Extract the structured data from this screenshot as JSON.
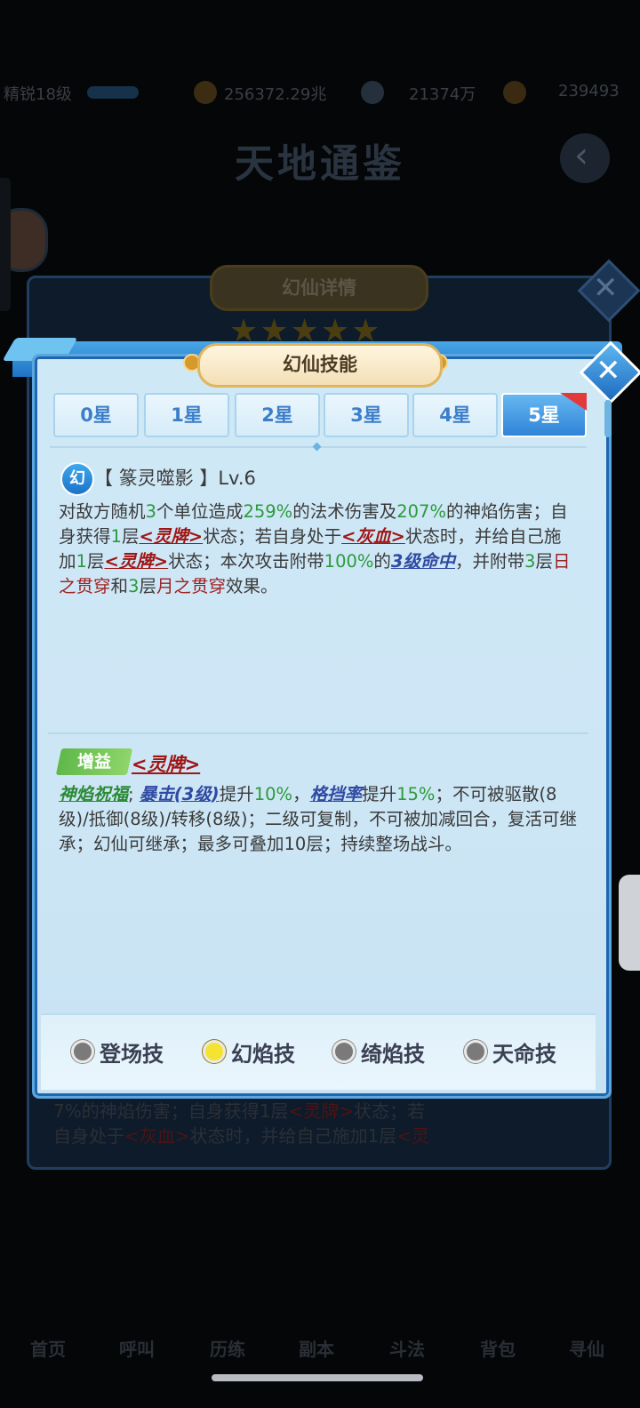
{
  "background": {
    "level_text": "精锐18级",
    "gold": "256372.29兆",
    "currency2": "21374万",
    "currency3": "239493",
    "screen_title": "天地通鉴",
    "detail_title": "幻仙详情",
    "detail_stars": "★★★★★",
    "dim_text_line1": "7%的神焰伤害；自身获得1层",
    "dim_text_line1_buff": "<灵牌>",
    "dim_text_line1_tail": "状态；若",
    "dim_text_line2": "自身处于",
    "dim_text_line2_buff": "<灰血>",
    "dim_text_line2_tail": "状态时，并给自己施加1层",
    "dim_text_line2_buff2": "<灵",
    "nav": [
      "首页",
      "呼叫",
      "历练",
      "副本",
      "斗法",
      "背包",
      "寻仙"
    ]
  },
  "dialog": {
    "title": "幻仙技能",
    "tabs": [
      "0星",
      "1星",
      "2星",
      "3星",
      "4星",
      "5星"
    ],
    "active_tab": "5星",
    "skill": {
      "icon_char": "幻",
      "name": "【 篆灵噬影 】Lv.6",
      "desc": [
        {
          "t": "对敌方随机",
          "c": ""
        },
        {
          "t": "3",
          "c": "g"
        },
        {
          "t": "个单位造成",
          "c": ""
        },
        {
          "t": "259%",
          "c": "g"
        },
        {
          "t": "的法术伤害及",
          "c": ""
        },
        {
          "t": "207%",
          "c": "g"
        },
        {
          "t": "的神焰伤害；自身获得",
          "c": ""
        },
        {
          "t": "1",
          "c": "g"
        },
        {
          "t": "层",
          "c": ""
        },
        {
          "t": "<灵牌>",
          "c": "ri"
        },
        {
          "t": "状态；若自身处于",
          "c": ""
        },
        {
          "t": "<灰血>",
          "c": "ri"
        },
        {
          "t": "状态时，并给自己施加",
          "c": ""
        },
        {
          "t": "1",
          "c": "g"
        },
        {
          "t": "层",
          "c": ""
        },
        {
          "t": "<灵牌>",
          "c": "ri"
        },
        {
          "t": "状态；本次攻击附带",
          "c": ""
        },
        {
          "t": "100%",
          "c": "g"
        },
        {
          "t": "的",
          "c": ""
        },
        {
          "t": "3级命中",
          "c": "bi"
        },
        {
          "t": "，并附带",
          "c": ""
        },
        {
          "t": "3",
          "c": "g"
        },
        {
          "t": "层",
          "c": ""
        },
        {
          "t": "日之贯穿",
          "c": "r"
        },
        {
          "t": "和",
          "c": ""
        },
        {
          "t": "3",
          "c": "g"
        },
        {
          "t": "层",
          "c": ""
        },
        {
          "t": "月之贯穿",
          "c": "r"
        },
        {
          "t": "效果。",
          "c": ""
        }
      ]
    },
    "buff": {
      "tag": "增益",
      "name": "<灵牌>",
      "desc": [
        {
          "t": "神焰祝福",
          "c": "gi"
        },
        {
          "t": "; ",
          "c": ""
        },
        {
          "t": "暴击(3级)",
          "c": "bi"
        },
        {
          "t": "提升",
          "c": ""
        },
        {
          "t": "10%",
          "c": "g"
        },
        {
          "t": "，",
          "c": ""
        },
        {
          "t": "格挡率",
          "c": "bi"
        },
        {
          "t": "提升",
          "c": ""
        },
        {
          "t": "15%",
          "c": "g"
        },
        {
          "t": "；不可被驱散(8级)/抵御(8级)/转移(8级)；二级可复制，不可被加减回合，复活可继承；幻仙可继承；最多可叠加10层；持续整场战斗。",
          "c": ""
        }
      ]
    },
    "skill_types": [
      {
        "label": "登场技",
        "selected": false
      },
      {
        "label": "幻焰技",
        "selected": true
      },
      {
        "label": "绮焰技",
        "selected": false
      },
      {
        "label": "天命技",
        "selected": false
      }
    ]
  }
}
